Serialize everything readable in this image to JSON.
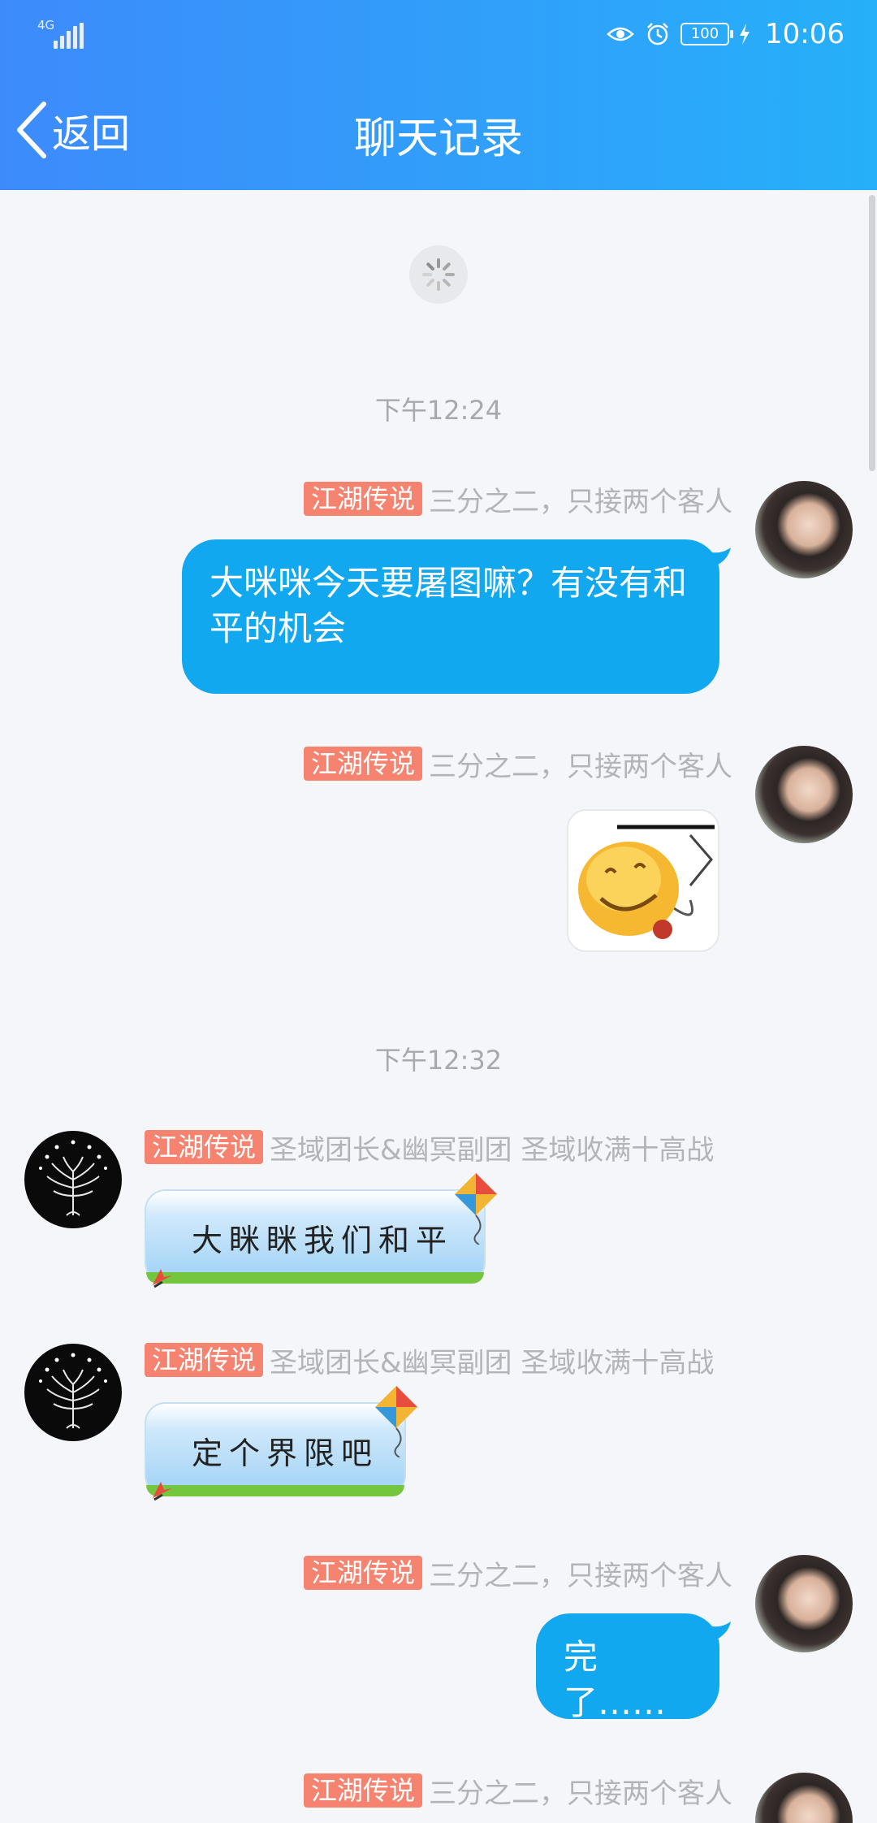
{
  "status_bar": {
    "network": "4G",
    "time": "10:06",
    "battery": "100",
    "icons": [
      "eye-comfort-icon",
      "alarm-icon",
      "charging-icon"
    ]
  },
  "nav": {
    "back_label": "返回",
    "title": "聊天记录"
  },
  "messages": {
    "ts1": "下午12:24",
    "ts2": "下午12:32",
    "m1": {
      "tag": "江湖传说",
      "nick": "三分之二，只接两个客人",
      "text": "大咪咪今天要屠图嘛？有没有和平的机会"
    },
    "m2": {
      "tag": "江湖传说",
      "nick": "三分之二，只接两个客人",
      "sticker": "smiley-sticker"
    },
    "m3": {
      "tag": "江湖传说",
      "nick": "圣域团长&幽冥副团 圣域收满十高战",
      "text": "大眯眯我们和平"
    },
    "m4": {
      "tag": "江湖传说",
      "nick": "圣域团长&幽冥副团 圣域收满十高战",
      "text": "定个界限吧"
    },
    "m5": {
      "tag": "江湖传说",
      "nick": "三分之二，只接两个客人",
      "text": "完了……"
    },
    "m6": {
      "tag": "江湖传说",
      "nick": "三分之二，只接两个客人"
    }
  },
  "colors": {
    "header_gradient_start": "#3d8bfb",
    "header_gradient_end": "#26b0f9",
    "bubble_me": "#12a8ef",
    "tag": "#f5836f"
  }
}
